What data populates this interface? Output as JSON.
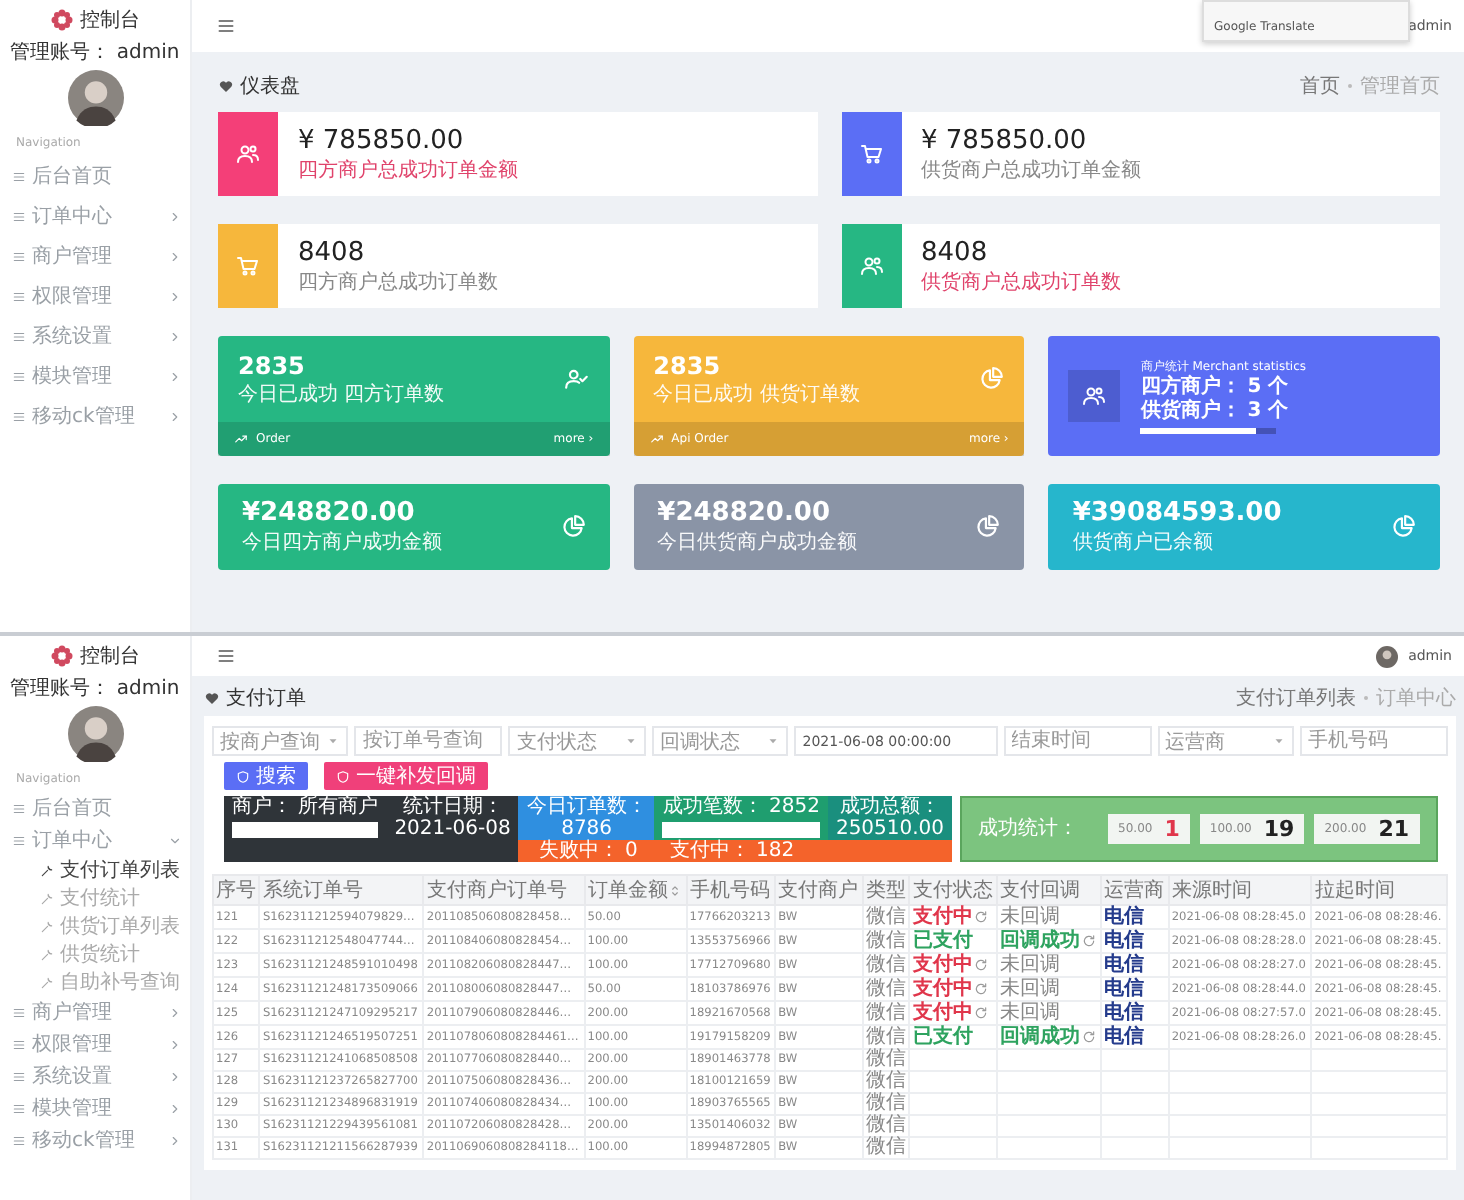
{
  "dashboard_screen": {
    "sidebar": {
      "brand": "控制台",
      "account": "管理账号： admin",
      "section": "Navigation",
      "items": [
        {
          "label": "后台首页",
          "kind": "link"
        },
        {
          "label": "订单中心",
          "kind": "group",
          "expanded": false
        },
        {
          "label": "商户管理",
          "kind": "group",
          "expanded": false
        },
        {
          "label": "权限管理",
          "kind": "group",
          "expanded": false
        },
        {
          "label": "系统设置",
          "kind": "group",
          "expanded": false
        },
        {
          "label": "模块管理",
          "kind": "group",
          "expanded": false
        },
        {
          "label": "移动ck管理",
          "kind": "group",
          "expanded": false
        }
      ]
    },
    "header": {
      "translate_popup": "Google Translate",
      "user": "admin"
    },
    "page_title": "仪表盘",
    "breadcrumb": [
      "首页",
      "管理首页"
    ],
    "summary_cards": [
      {
        "value": "¥ 785850.00",
        "label": "四方商户总成功订单金额",
        "color": "#f43f78",
        "label_alert": true
      },
      {
        "value": "¥ 785850.00",
        "label": "供货商户总成功订单金额",
        "color": "#5b6ef5",
        "label_alert": false
      },
      {
        "value": "8408",
        "label": "四方商户总成功订单数",
        "color": "#f6b73c",
        "label_alert": false
      },
      {
        "value": "8408",
        "label": "供货商户总成功订单数",
        "color": "#26b783",
        "label_alert": true
      }
    ],
    "stat_tiles": [
      {
        "kind": "counter",
        "value": "2835",
        "label": "今日已成功 四方订单数",
        "footer": "Order",
        "more": "more ›",
        "color": "#26b783"
      },
      {
        "kind": "counter",
        "value": "2835",
        "label": "今日已成功 供货订单数",
        "footer": "Api Order",
        "more": "more ›",
        "color": "#f6b73c"
      },
      {
        "kind": "merchants",
        "title": "商户统计 Merchant statistics",
        "lines": [
          "四方商户： 5 个",
          "供货商户： 3 个"
        ],
        "level": 0.85,
        "color": "#5b6ef5"
      }
    ],
    "amount_tiles": [
      {
        "value": "¥248820.00",
        "label": "今日四方商户成功金额",
        "color": "#26b783"
      },
      {
        "value": "¥248820.00",
        "label": "今日供货商户成功金额",
        "color": "#8a94a6"
      },
      {
        "value": "¥39084593.00",
        "label": "供货商户已余额",
        "color": "#26b6cc"
      }
    ]
  },
  "orders_screen": {
    "sidebar": {
      "brand": "控制台",
      "account": "管理账号： admin",
      "section": "Navigation",
      "items": [
        {
          "label": "后台首页",
          "kind": "link"
        },
        {
          "label": "订单中心",
          "kind": "group",
          "expanded": true,
          "children": [
            {
              "label": "支付订单列表",
              "selected": true
            },
            {
              "label": "支付统计",
              "selected": false
            },
            {
              "label": "供货订单列表",
              "selected": false
            },
            {
              "label": "供货统计",
              "selected": false
            },
            {
              "label": "自助补号查询",
              "selected": false
            }
          ]
        },
        {
          "label": "商户管理",
          "kind": "group",
          "expanded": false
        },
        {
          "label": "权限管理",
          "kind": "group",
          "expanded": false
        },
        {
          "label": "系统设置",
          "kind": "group",
          "expanded": false
        },
        {
          "label": "模块管理",
          "kind": "group",
          "expanded": false
        },
        {
          "label": "移动ck管理",
          "kind": "group",
          "expanded": false
        }
      ]
    },
    "header": {
      "user": "admin"
    },
    "page_title": "支付订单",
    "breadcrumb": [
      "支付订单列表",
      "订单中心"
    ],
    "filters": [
      {
        "kind": "select",
        "placeholder": "按商户查询"
      },
      {
        "kind": "input",
        "placeholder": "按订单号查询"
      },
      {
        "kind": "select",
        "placeholder": "支付状态"
      },
      {
        "kind": "select",
        "placeholder": "回调状态"
      },
      {
        "kind": "input",
        "value": "2021-06-08 00:00:00"
      },
      {
        "kind": "input",
        "placeholder": "结束时间"
      },
      {
        "kind": "select",
        "placeholder": "运营商"
      },
      {
        "kind": "input",
        "placeholder": "手机号码"
      }
    ],
    "buttons": [
      "搜索",
      "一键补发回调"
    ],
    "stats": {
      "merchant": "商户： 所有商户",
      "date_label": "统计日期：",
      "date": "2021-06-08",
      "today_label": "今日订单数：",
      "today": "8786",
      "success_count": "成功笔数： 2852",
      "success_total_label": "成功总额：",
      "success_total": "250510.00",
      "failed": "失败中： 0",
      "paying": "支付中： 182",
      "breakdown_label": "成功统计：",
      "breakdown": [
        {
          "amount": "50.00",
          "count": "1",
          "alert": true
        },
        {
          "amount": "100.00",
          "count": "19",
          "alert": false
        },
        {
          "amount": "200.00",
          "count": "21",
          "alert": false
        }
      ]
    },
    "table": {
      "columns": [
        {
          "label": "序号",
          "sortable": false
        },
        {
          "label": "系统订单号",
          "sortable": false
        },
        {
          "label": "支付商户订单号",
          "sortable": false
        },
        {
          "label": "订单金额",
          "sortable": true
        },
        {
          "label": "手机号码",
          "sortable": false
        },
        {
          "label": "支付商户",
          "sortable": false
        },
        {
          "label": "类型",
          "sortable": false
        },
        {
          "label": "支付状态",
          "sortable": false
        },
        {
          "label": "支付回调",
          "sortable": false
        },
        {
          "label": "运营商",
          "sortable": false
        },
        {
          "label": "来源时间",
          "sortable": false
        },
        {
          "label": "拉起时间",
          "sortable": false
        }
      ],
      "rows": [
        {
          "seq": "121",
          "order_no": "S162311212594079829…",
          "merchant_order_no": "201108506080828458…",
          "amount": "50.00",
          "phone": "17766203213",
          "merchant": "BW",
          "type": "微信",
          "pay_status": {
            "text": "支付中",
            "kind": "pending",
            "retry": true
          },
          "callback": {
            "text": "未回调",
            "kind": "none",
            "retry": false
          },
          "operator": "电信",
          "created": "2021-06-08 08:28:45.0",
          "launched": "2021-06-08 08:28:46."
        },
        {
          "seq": "122",
          "order_no": "S162311212548047744…",
          "merchant_order_no": "201108406080828454…",
          "amount": "100.00",
          "phone": "13553756966",
          "merchant": "BW",
          "type": "微信",
          "pay_status": {
            "text": "已支付",
            "kind": "success",
            "retry": false
          },
          "callback": {
            "text": "回调成功",
            "kind": "success",
            "retry": true
          },
          "operator": "电信",
          "created": "2021-06-08 08:28:28.0",
          "launched": "2021-06-08 08:28:45."
        },
        {
          "seq": "123",
          "order_no": "S16231121248591010498",
          "merchant_order_no": "201108206080828447…",
          "amount": "100.00",
          "phone": "17712709680",
          "merchant": "BW",
          "type": "微信",
          "pay_status": {
            "text": "支付中",
            "kind": "pending",
            "retry": true
          },
          "callback": {
            "text": "未回调",
            "kind": "none",
            "retry": false
          },
          "operator": "电信",
          "created": "2021-06-08 08:28:27.0",
          "launched": "2021-06-08 08:28:45."
        },
        {
          "seq": "124",
          "order_no": "S16231121248173509066",
          "merchant_order_no": "201108006080828447…",
          "amount": "50.00",
          "phone": "18103786976",
          "merchant": "BW",
          "type": "微信",
          "pay_status": {
            "text": "支付中",
            "kind": "pending",
            "retry": true
          },
          "callback": {
            "text": "未回调",
            "kind": "none",
            "retry": false
          },
          "operator": "电信",
          "created": "2021-06-08 08:28:44.0",
          "launched": "2021-06-08 08:28:45."
        },
        {
          "seq": "125",
          "order_no": "S16231121247109295217",
          "merchant_order_no": "201107906080828446…",
          "amount": "200.00",
          "phone": "18921670568",
          "merchant": "BW",
          "type": "微信",
          "pay_status": {
            "text": "支付中",
            "kind": "pending",
            "retry": true
          },
          "callback": {
            "text": "未回调",
            "kind": "none",
            "retry": false
          },
          "operator": "电信",
          "created": "2021-06-08 08:27:57.0",
          "launched": "2021-06-08 08:28:45."
        },
        {
          "seq": "126",
          "order_no": "S16231121246519507251",
          "merchant_order_no": "2011078060808284461…",
          "amount": "100.00",
          "phone": "19179158209",
          "merchant": "BW",
          "type": "微信",
          "pay_status": {
            "text": "已支付",
            "kind": "success",
            "retry": false
          },
          "callback": {
            "text": "回调成功",
            "kind": "success",
            "retry": true
          },
          "operator": "电信",
          "created": "2021-06-08 08:28:26.0",
          "launched": "2021-06-08 08:28:45."
        },
        {
          "seq": "127",
          "order_no": "S16231121241068508508",
          "merchant_order_no": "201107706080828440…",
          "amount": "200.00",
          "phone": "18901463778",
          "merchant": "BW",
          "type": "微信"
        },
        {
          "seq": "128",
          "order_no": "S16231121237265827700",
          "merchant_order_no": "201107506080828436…",
          "amount": "200.00",
          "phone": "18100121659",
          "merchant": "BW",
          "type": "微信"
        },
        {
          "seq": "129",
          "order_no": "S16231121234896831919",
          "merchant_order_no": "201107406080828434…",
          "amount": "100.00",
          "phone": "18903765565",
          "merchant": "BW",
          "type": "微信"
        },
        {
          "seq": "130",
          "order_no": "S16231121229439561081",
          "merchant_order_no": "201107206080828428…",
          "amount": "200.00",
          "phone": "13501406032",
          "merchant": "BW",
          "type": "微信"
        },
        {
          "seq": "131",
          "order_no": "S16231121211566287939",
          "merchant_order_no": "2011069060808284118…",
          "amount": "100.00",
          "phone": "18994872805",
          "merchant": "BW",
          "type": "微信"
        }
      ]
    }
  }
}
